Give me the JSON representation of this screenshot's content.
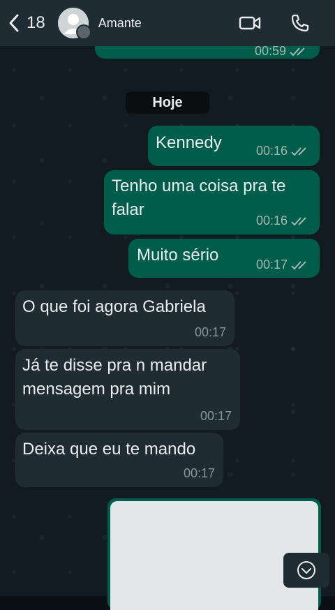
{
  "header": {
    "back_count": "18",
    "contact_name": "Amante"
  },
  "chat": {
    "date_separator": "Hoje",
    "previous_message_time": "00:59",
    "messages": [
      {
        "direction": "outgoing",
        "text": "Kennedy",
        "time": "00:16",
        "status": "read"
      },
      {
        "direction": "outgoing",
        "text": "Tenho uma coisa pra te falar",
        "time": "00:16",
        "status": "read"
      },
      {
        "direction": "outgoing",
        "text": "Muito sério",
        "time": "00:17",
        "status": "read"
      },
      {
        "direction": "incoming",
        "text": "O que foi agora Gabriela",
        "time": "00:17"
      },
      {
        "direction": "incoming",
        "text": "Já te disse pra n mandar mensagem pra mim",
        "time": "00:17"
      },
      {
        "direction": "incoming",
        "text": "Deixa que eu te mando",
        "time": "00:17"
      }
    ],
    "media_message": {
      "direction": "outgoing",
      "type": "image"
    }
  },
  "icons": {
    "back": "chevron-left-icon",
    "video": "video-camera-icon",
    "call": "phone-icon",
    "scroll": "chevron-down-circle-icon"
  },
  "colors": {
    "outgoing_bubble": "#005c4b",
    "incoming_bubble": "#202c33",
    "header": "#1f2c34",
    "read_ticks": "#a6b6b0"
  }
}
